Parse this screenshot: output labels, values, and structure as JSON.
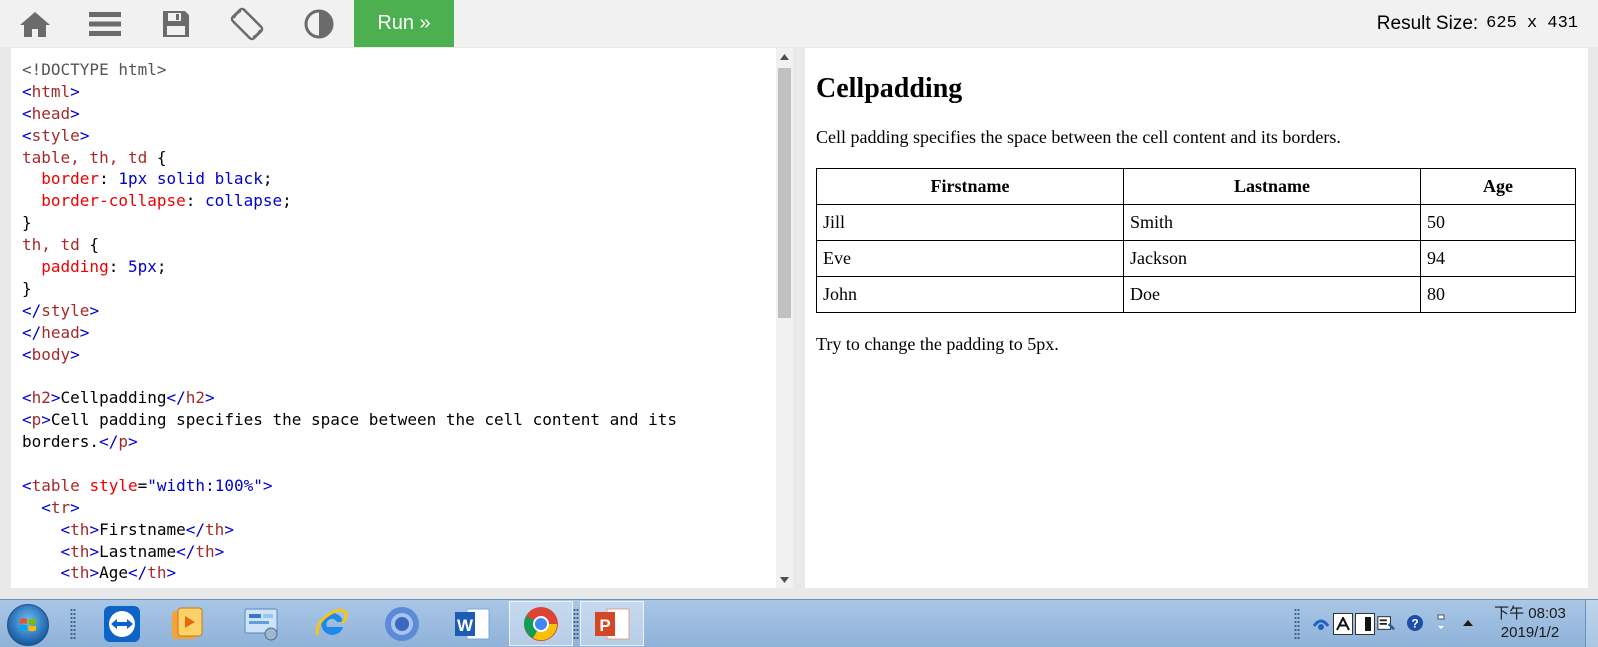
{
  "toolbar": {
    "icons": [
      "home-icon",
      "menu-icon",
      "save-icon",
      "rotate-icon",
      "contrast-icon"
    ],
    "run_label": "Run »",
    "result_size_label": "Result Size:",
    "result_size_value": "625 x 431"
  },
  "editor": {
    "lines": [
      [
        [
          "t-doc",
          "<!DOCTYPE html>"
        ]
      ],
      [
        [
          "t-br",
          "<"
        ],
        [
          "t-tag",
          "html"
        ],
        [
          "t-br",
          ">"
        ]
      ],
      [
        [
          "t-br",
          "<"
        ],
        [
          "t-tag",
          "head"
        ],
        [
          "t-br",
          ">"
        ]
      ],
      [
        [
          "t-br",
          "<"
        ],
        [
          "t-tag",
          "style"
        ],
        [
          "t-br",
          ">"
        ]
      ],
      [
        [
          "t-sel",
          "table, th, td"
        ],
        [
          "t-pun",
          " {"
        ]
      ],
      [
        [
          "t-pun",
          "  "
        ],
        [
          "t-prop",
          "border"
        ],
        [
          "t-pun",
          ": "
        ],
        [
          "t-val",
          "1px solid black"
        ],
        [
          "t-pun",
          ";"
        ]
      ],
      [
        [
          "t-pun",
          "  "
        ],
        [
          "t-prop",
          "border-collapse"
        ],
        [
          "t-pun",
          ": "
        ],
        [
          "t-val",
          "collapse"
        ],
        [
          "t-pun",
          ";"
        ]
      ],
      [
        [
          "t-pun",
          "}"
        ]
      ],
      [
        [
          "t-sel",
          "th, td"
        ],
        [
          "t-pun",
          " {"
        ]
      ],
      [
        [
          "t-pun",
          "  "
        ],
        [
          "t-prop",
          "padding"
        ],
        [
          "t-pun",
          ": "
        ],
        [
          "t-val",
          "5px"
        ],
        [
          "t-pun",
          ";"
        ]
      ],
      [
        [
          "t-pun",
          "}"
        ]
      ],
      [
        [
          "t-br",
          "</"
        ],
        [
          "t-tag",
          "style"
        ],
        [
          "t-br",
          ">"
        ]
      ],
      [
        [
          "t-br",
          "</"
        ],
        [
          "t-tag",
          "head"
        ],
        [
          "t-br",
          ">"
        ]
      ],
      [
        [
          "t-br",
          "<"
        ],
        [
          "t-tag",
          "body"
        ],
        [
          "t-br",
          ">"
        ]
      ],
      [
        [
          "t-txt",
          ""
        ]
      ],
      [
        [
          "t-br",
          "<"
        ],
        [
          "t-tag",
          "h2"
        ],
        [
          "t-br",
          ">"
        ],
        [
          "t-txt",
          "Cellpadding"
        ],
        [
          "t-br",
          "</"
        ],
        [
          "t-tag",
          "h2"
        ],
        [
          "t-br",
          ">"
        ]
      ],
      [
        [
          "t-br",
          "<"
        ],
        [
          "t-tag",
          "p"
        ],
        [
          "t-br",
          ">"
        ],
        [
          "t-txt",
          "Cell padding specifies the space between the cell content and its"
        ]
      ],
      [
        [
          "t-txt",
          "borders."
        ],
        [
          "t-br",
          "</"
        ],
        [
          "t-tag",
          "p"
        ],
        [
          "t-br",
          ">"
        ]
      ],
      [
        [
          "t-txt",
          ""
        ]
      ],
      [
        [
          "t-br",
          "<"
        ],
        [
          "t-tag",
          "table"
        ],
        [
          "t-txt",
          " "
        ],
        [
          "t-attr",
          "style"
        ],
        [
          "t-txt",
          "="
        ],
        [
          "t-str",
          "\"width:100%\""
        ],
        [
          "t-br",
          ">"
        ]
      ],
      [
        [
          "t-txt",
          "  "
        ],
        [
          "t-br",
          "<"
        ],
        [
          "t-tag",
          "tr"
        ],
        [
          "t-br",
          ">"
        ]
      ],
      [
        [
          "t-txt",
          "    "
        ],
        [
          "t-br",
          "<"
        ],
        [
          "t-tag",
          "th"
        ],
        [
          "t-br",
          ">"
        ],
        [
          "t-txt",
          "Firstname"
        ],
        [
          "t-br",
          "</"
        ],
        [
          "t-tag",
          "th"
        ],
        [
          "t-br",
          ">"
        ]
      ],
      [
        [
          "t-txt",
          "    "
        ],
        [
          "t-br",
          "<"
        ],
        [
          "t-tag",
          "th"
        ],
        [
          "t-br",
          ">"
        ],
        [
          "t-txt",
          "Lastname"
        ],
        [
          "t-br",
          "</"
        ],
        [
          "t-tag",
          "th"
        ],
        [
          "t-br",
          ">"
        ]
      ],
      [
        [
          "t-txt",
          "    "
        ],
        [
          "t-br",
          "<"
        ],
        [
          "t-tag",
          "th"
        ],
        [
          "t-br",
          ">"
        ],
        [
          "t-txt",
          "Age"
        ],
        [
          "t-br",
          "</"
        ],
        [
          "t-tag",
          "th"
        ],
        [
          "t-br",
          ">"
        ]
      ]
    ]
  },
  "result": {
    "heading": "Cellpadding",
    "intro": "Cell padding specifies the space between the cell content and its borders.",
    "table": {
      "headers": [
        "Firstname",
        "Lastname",
        "Age"
      ],
      "rows": [
        [
          "Jill",
          "Smith",
          "50"
        ],
        [
          "Eve",
          "Jackson",
          "94"
        ],
        [
          "John",
          "Doe",
          "80"
        ]
      ]
    },
    "footer": "Try to change the padding to 5px."
  },
  "taskbar": {
    "apps": [
      "teamviewer-icon",
      "media-player-icon",
      "control-panel-icon",
      "internet-explorer-icon",
      "chromium-icon",
      "word-icon",
      "chrome-icon",
      "powerpoint-icon"
    ],
    "tray_icons": [
      "network-icon",
      "ime-a-icon",
      "ime-pad-icon",
      "ime-dict-icon",
      "help-icon"
    ],
    "clock_time": "下午 08:03",
    "clock_date": "2019/1/2"
  },
  "colors": {
    "run_button": "#4caf50",
    "tag": "#a52a2a",
    "bracket": "#0000cd",
    "property": "#ee0000",
    "value": "#0000cd"
  }
}
